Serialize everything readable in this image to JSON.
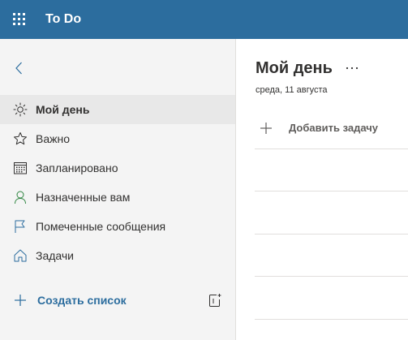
{
  "app": {
    "title": "To Do",
    "brand_color": "#2c6d9e",
    "waffle_icon": "app-launcher-icon"
  },
  "sidebar": {
    "back_icon": "chevron-left-icon",
    "items": [
      {
        "label": "Мой день",
        "icon": "sun-icon",
        "selected": true
      },
      {
        "label": "Важно",
        "icon": "star-icon",
        "selected": false
      },
      {
        "label": "Запланировано",
        "icon": "calendar-icon",
        "selected": false
      },
      {
        "label": "Назначенные вам",
        "icon": "person-icon",
        "selected": false
      },
      {
        "label": "Помеченные сообщения",
        "icon": "flag-icon",
        "selected": false
      },
      {
        "label": "Задачи",
        "icon": "home-icon",
        "selected": false
      }
    ],
    "create_list_label": "Создать список",
    "create_list_icon": "plus-icon",
    "new_group_icon": "new-group-icon"
  },
  "main": {
    "title": "Мой день",
    "more_icon": "more-options-icon",
    "date": "среда, 11 августа",
    "add_task_label": "Добавить задачу",
    "add_task_icon": "plus-icon"
  }
}
